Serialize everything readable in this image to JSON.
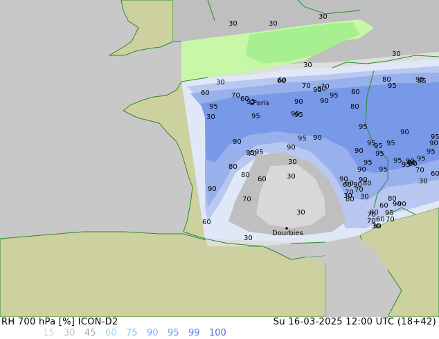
{
  "map": {
    "colors": {
      "ocean": "#c8c8c8",
      "land_outside": "#cdd1a0",
      "rh_30": "#bfbfbf",
      "rh_30_light": "#dedede",
      "rh_45_green": "#c8f7a8",
      "rh_60_green": "#a6f090",
      "rh_70": "#e0e8f8",
      "rh_80": "#b8c8f0",
      "rh_90": "#98b0ec",
      "rh_95": "#7898e8",
      "border": "#2a8a2a",
      "contour": "#9a9a9a"
    },
    "cities": [
      {
        "name": "Paris"
      },
      {
        "name": "Dourbies"
      }
    ],
    "contour_labels": [
      "30",
      "30",
      "30",
      "30",
      "30",
      "30",
      "60",
      "60",
      "70",
      "70",
      "80",
      "95",
      "30",
      "60",
      "60",
      "70",
      "80",
      "95",
      "95",
      "95",
      "90",
      "90",
      "80",
      "95",
      "80",
      "95",
      "90",
      "95",
      "95",
      "95",
      "90",
      "95",
      "95",
      "95",
      "95",
      "90",
      "90",
      "90",
      "80",
      "90",
      "70",
      "30",
      "80",
      "90",
      "70",
      "60",
      "30",
      "60",
      "30",
      "95",
      "95",
      "90",
      "95",
      "95",
      "95",
      "95",
      "95",
      "90",
      "90",
      "95",
      "95",
      "90",
      "80",
      "70",
      "60",
      "90",
      "95",
      "95",
      "90",
      "90",
      "60",
      "30",
      "70",
      "60",
      "80",
      "70",
      "80",
      "80",
      "90",
      "70",
      "30",
      "80",
      "95",
      "70",
      "60",
      "30",
      "30",
      "90",
      "70",
      "30",
      "30",
      "60"
    ]
  },
  "footer": {
    "title": "RH 700 hPa [%] ICON-D2",
    "datetime": "Su 16-03-2025 12:00 UTC (18+42)",
    "legend": [
      {
        "label": "15",
        "color": "#d4d4d4"
      },
      {
        "label": "30",
        "color": "#bdbdbd"
      },
      {
        "label": "45",
        "color": "#a6a6a6"
      },
      {
        "label": "60",
        "color": "#9fd2f0"
      },
      {
        "label": "75",
        "color": "#8ec4ee"
      },
      {
        "label": "90",
        "color": "#7ab2ea"
      },
      {
        "label": "95",
        "color": "#6a9ae4"
      },
      {
        "label": "99",
        "color": "#5a84de"
      },
      {
        "label": "100",
        "color": "#4a70d6"
      }
    ]
  }
}
